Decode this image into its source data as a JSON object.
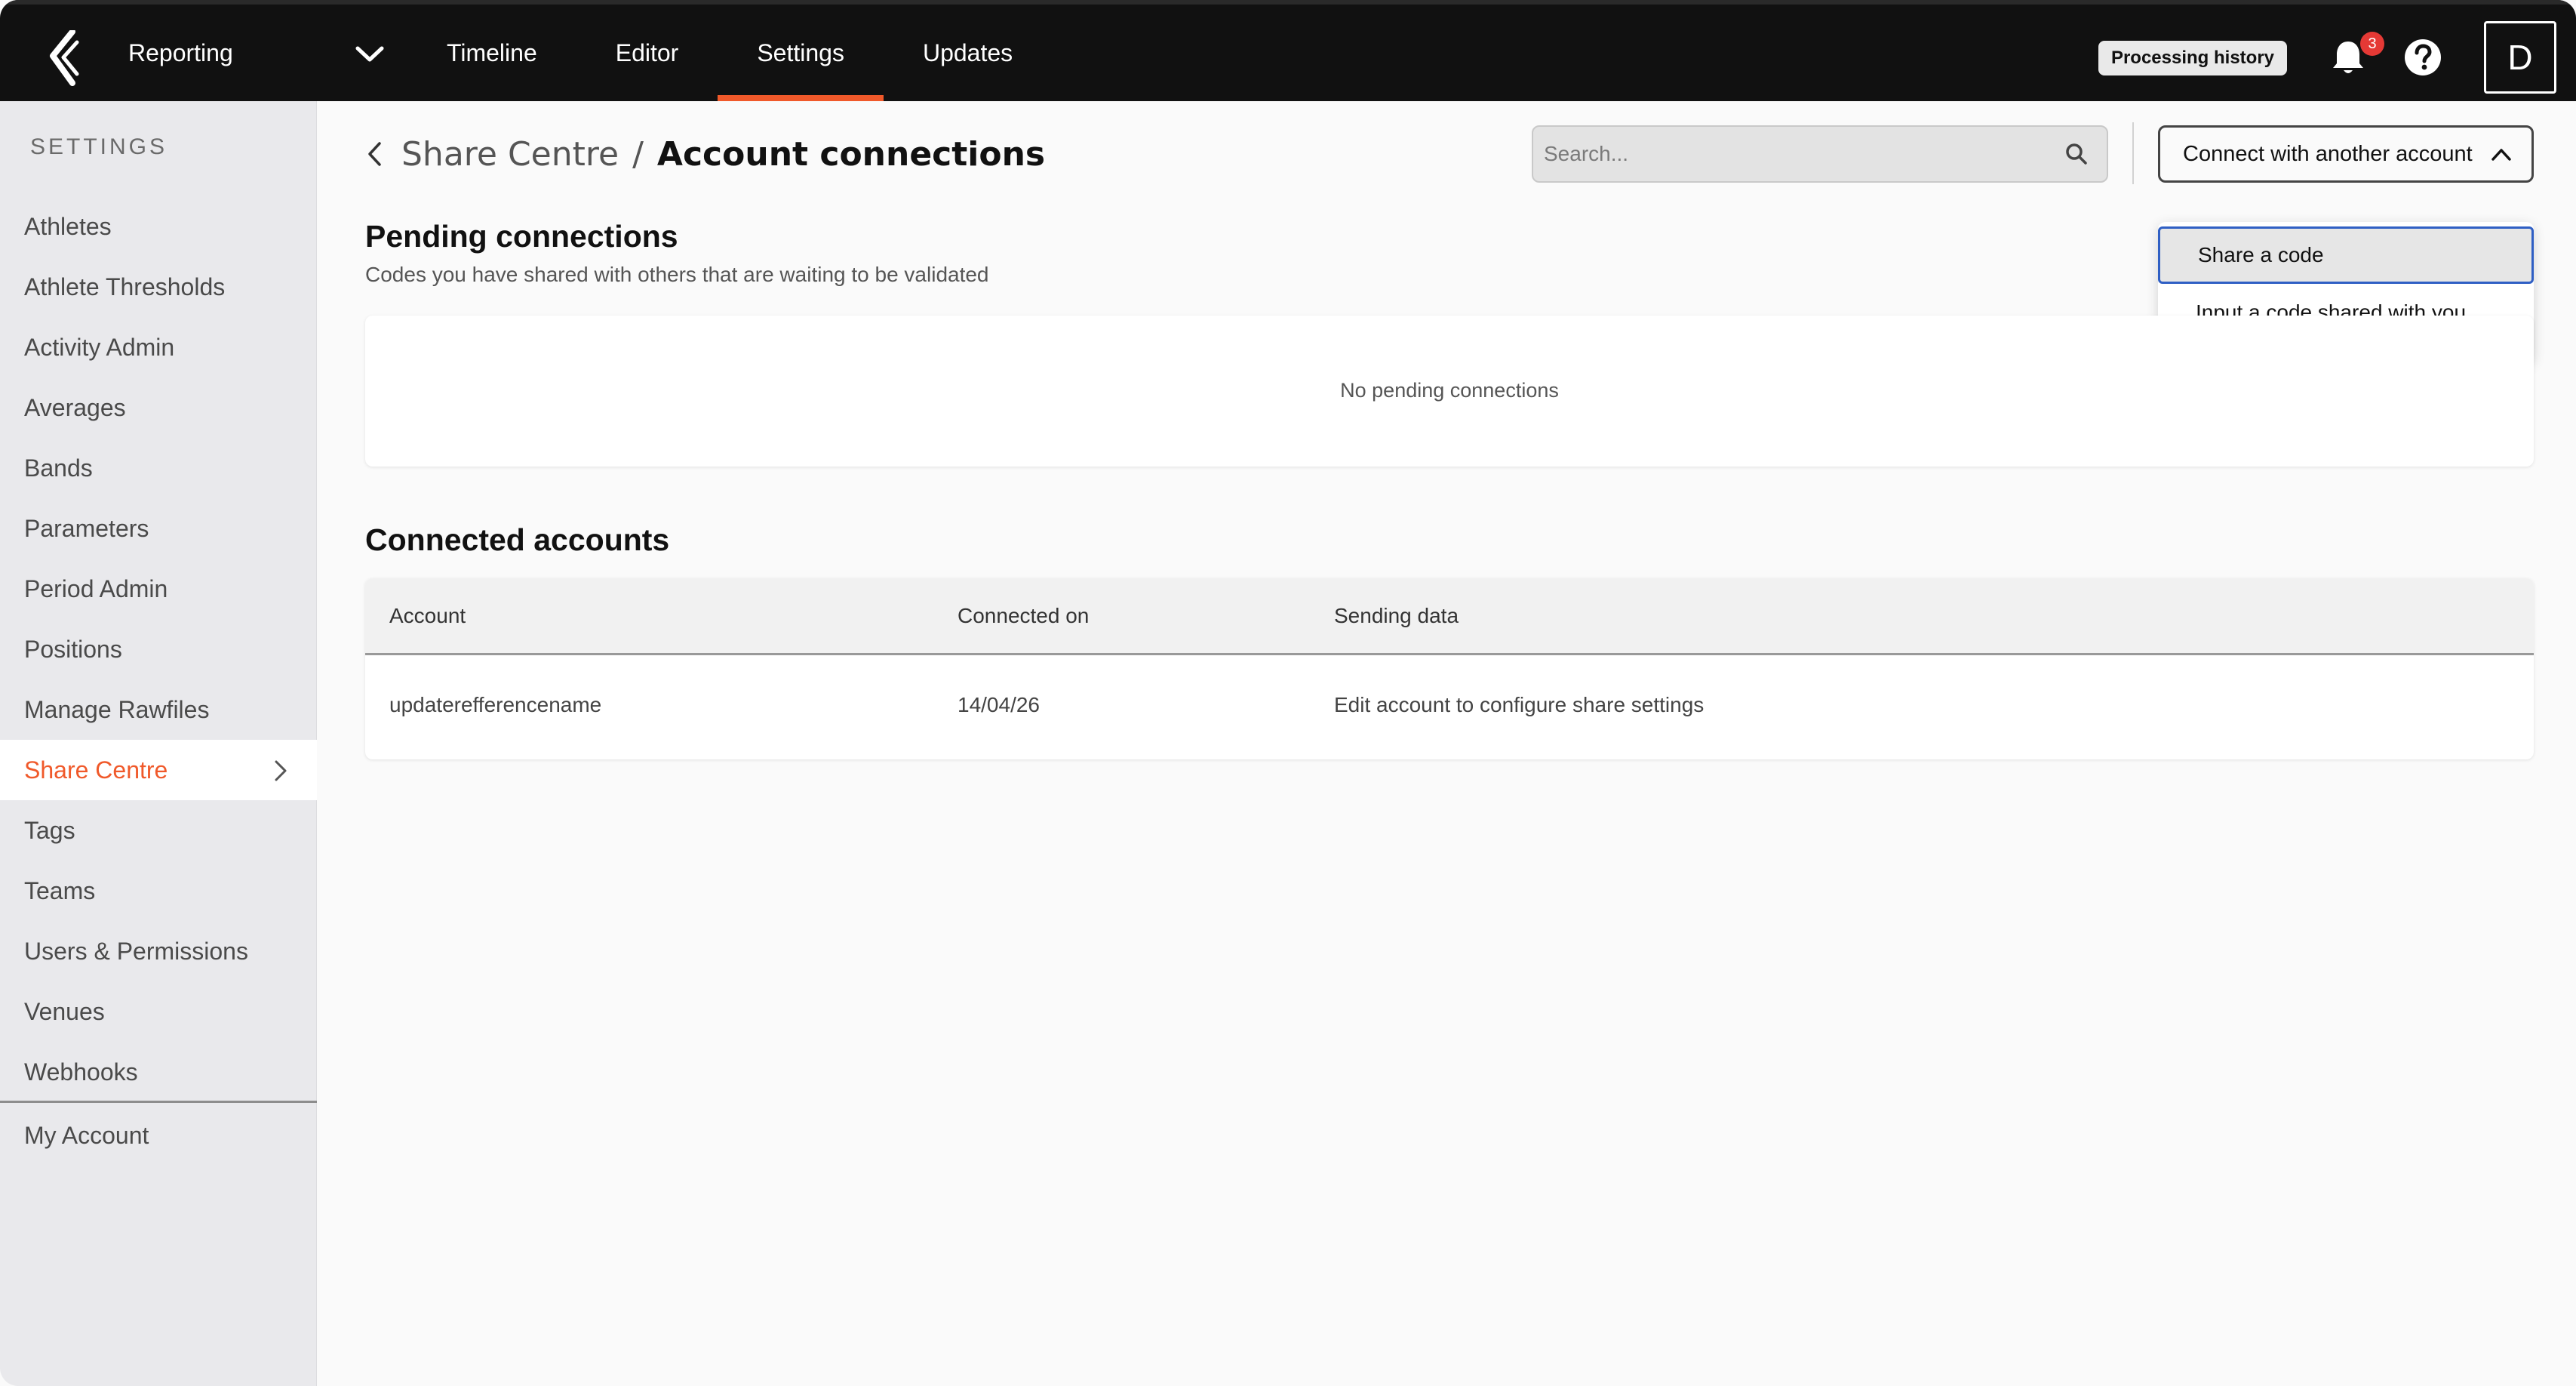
{
  "topbar": {
    "app_switcher_label": "Reporting",
    "nav_tabs": [
      "Timeline",
      "Editor",
      "Settings",
      "Updates"
    ],
    "active_tab": "Settings",
    "processing_history_label": "Processing history",
    "notification_count": "3",
    "avatar_initial": "D",
    "accent_color": "#f0592a"
  },
  "sidebar": {
    "heading": "SETTINGS",
    "items": [
      "Athletes",
      "Athlete Thresholds",
      "Activity Admin",
      "Averages",
      "Bands",
      "Parameters",
      "Period Admin",
      "Positions",
      "Manage Rawfiles",
      "Share Centre",
      "Tags",
      "Teams",
      "Users & Permissions",
      "Venues",
      "Webhooks"
    ],
    "active_item": "Share Centre",
    "account_item": "My Account"
  },
  "breadcrumb": {
    "parent": "Share Centre",
    "separator": "/",
    "current": "Account connections"
  },
  "search": {
    "placeholder": "Search..."
  },
  "connect_menu": {
    "button_label": "Connect with another account",
    "options": [
      "Share a code",
      "Input a code shared with you"
    ],
    "selected_option": "Share a code"
  },
  "pending": {
    "title": "Pending connections",
    "subtitle": "Codes you have shared with others that are waiting to be validated",
    "empty_message": "No pending connections"
  },
  "connected": {
    "title": "Connected accounts",
    "columns": [
      "Account",
      "Connected on",
      "Sending data"
    ],
    "rows": [
      {
        "account": "updaterefferencename",
        "connected_on": "14/04/26",
        "sending_data": "Edit account to configure share settings"
      }
    ]
  }
}
